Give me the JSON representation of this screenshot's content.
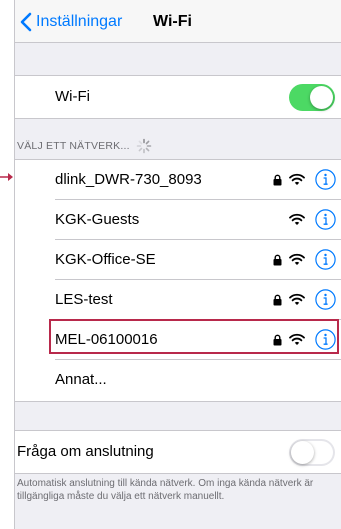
{
  "navbar": {
    "back_label": "Inställningar",
    "title": "Wi-Fi"
  },
  "wifi_toggle": {
    "label": "Wi-Fi",
    "state": "on"
  },
  "networks_header": "VÄLJ ETT NÄTVERK...",
  "networks": [
    {
      "name": "dlink_DWR-730_8093",
      "secured": true
    },
    {
      "name": "KGK-Guests",
      "secured": false
    },
    {
      "name": "KGK-Office-SE",
      "secured": true
    },
    {
      "name": "LES-test",
      "secured": true
    },
    {
      "name": "MEL-06100016",
      "secured": true,
      "highlighted": true
    }
  ],
  "other_network_label": "Annat...",
  "ask_to_join": {
    "label": "Fråga om anslutning",
    "state": "off",
    "footer": "Automatisk anslutning till kända nätverk. Om inga kända nätverk är tillgängliga måste du välja ett nätverk manuellt."
  },
  "colors": {
    "accent": "#007aff",
    "switch_on": "#4cd964",
    "highlight_border": "#b8294b"
  },
  "icons": [
    "chevron-left-icon",
    "spinner-icon",
    "lock-icon",
    "wifi-icon",
    "info-icon",
    "arrow-right-icon"
  ]
}
